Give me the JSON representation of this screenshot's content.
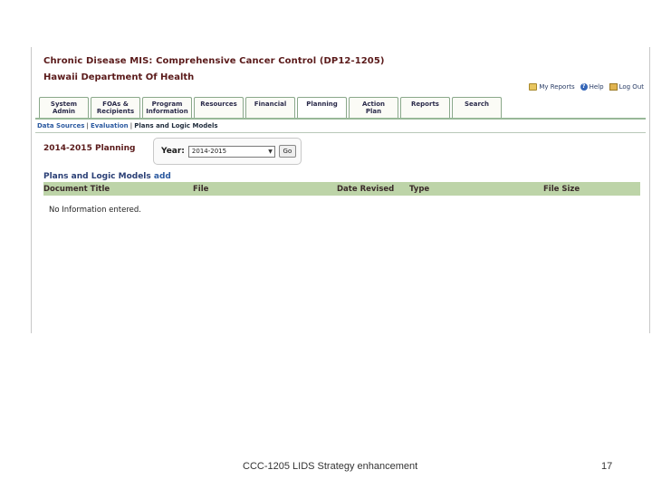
{
  "header": {
    "title": "Chronic Disease MIS: Comprehensive Cancer Control (DP12-1205)",
    "subtitle": "Hawaii Department Of Health"
  },
  "utility_links": [
    {
      "label": "My Reports",
      "icon": "report-icon"
    },
    {
      "label": "Help",
      "icon": "help-icon"
    },
    {
      "label": "Log Out",
      "icon": "logout-icon"
    }
  ],
  "tabs": [
    {
      "line1": "System",
      "line2": "Admin"
    },
    {
      "line1": "FOAs &",
      "line2": "Recipients"
    },
    {
      "line1": "Program",
      "line2": "Information"
    },
    {
      "line1": "Resources",
      "line2": ""
    },
    {
      "line1": "Financial",
      "line2": ""
    },
    {
      "line1": "Planning",
      "line2": ""
    },
    {
      "line1": "Action",
      "line2": "Plan"
    },
    {
      "line1": "Reports",
      "line2": ""
    },
    {
      "line1": "Search",
      "line2": ""
    }
  ],
  "active_tab": "Planning",
  "subnav": {
    "items": [
      "Data Sources",
      "Evaluation"
    ],
    "current": "Plans and Logic Models"
  },
  "planning": {
    "heading": "2014-2015 Planning",
    "year_label": "Year:",
    "year_value": "2014-2015",
    "go_label": "Go"
  },
  "plans": {
    "heading": "Plans and Logic Models",
    "add_link": "add",
    "columns": [
      "Document Title",
      "File",
      "Date Revised",
      "Type",
      "File Size"
    ],
    "empty_message": "No Information entered."
  },
  "slide": {
    "footer": "CCC-1205 LIDS Strategy enhancement",
    "page_number": "17"
  }
}
